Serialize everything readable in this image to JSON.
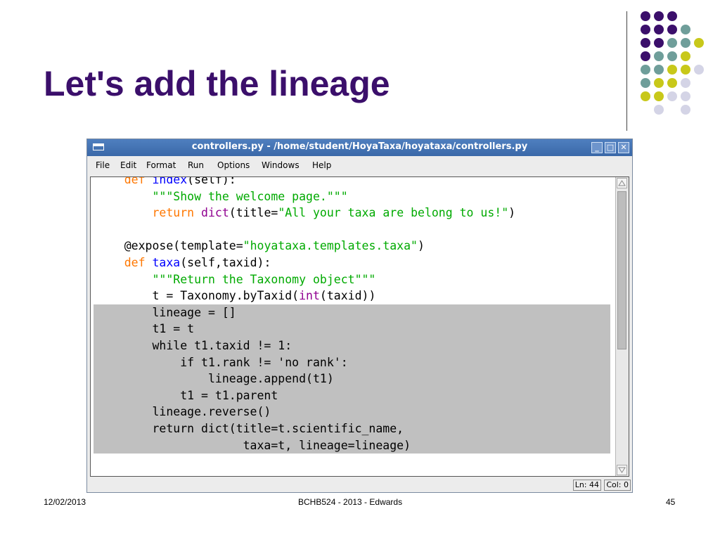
{
  "slide": {
    "title": "Let's add the lineage",
    "footer_date": "12/02/2013",
    "footer_center": "BCHB524 - 2013 - Edwards",
    "footer_page": "45"
  },
  "window": {
    "title": "controllers.py - /home/student/HoyaTaxa/hoyataxa/controllers.py",
    "minimize": "_",
    "maximize": "□",
    "close": "✕"
  },
  "menu": {
    "file": "File",
    "edit": "Edit",
    "format": "Format",
    "run": "Run",
    "options": "Options",
    "windows": "Windows",
    "help": "Help"
  },
  "code": {
    "l1": {
      "kw": "def",
      "name": "index",
      "rest": "(self):"
    },
    "l2": "\"\"\"Show the welcome page.\"\"\"",
    "l3": {
      "kw": "return",
      "bi": "dict",
      "a": "(title=",
      "str": "\"All your taxa are belong to us!\"",
      "b": ")"
    },
    "l5": {
      "a": "@expose(template=",
      "str": "\"hoyataxa.templates.taxa\"",
      "b": ")"
    },
    "l6": {
      "kw": "def",
      "name": "taxa",
      "rest": "(self,taxid):"
    },
    "l7": "\"\"\"Return the Taxonomy object\"\"\"",
    "l8": {
      "a": "t = Taxonomy.byTaxid(",
      "bi": "int",
      "b": "(taxid))"
    },
    "l9": "lineage = []",
    "l10": "t1 = t",
    "l11": "while t1.taxid != 1:",
    "l12": "if t1.rank != 'no rank':",
    "l13": "lineage.append(t1)",
    "l14": "t1 = t1.parent",
    "l15": "lineage.reverse()",
    "l16": "return dict(title=t.scientific_name,",
    "l17": "taxa=t, lineage=lineage)"
  },
  "status": {
    "line": "Ln: 44",
    "col": "Col: 0"
  },
  "colors": {
    "title": "#3b0f6b",
    "keyword": "#ff7700",
    "function_name": "#0000ff",
    "string": "#00aa00",
    "builtin": "#900090",
    "selection": "#c0c0c0",
    "dot_purple": "#3b0f6b",
    "dot_teal": "#6f9e9a",
    "dot_yellow": "#c8c81a",
    "dot_lavender": "#d4d4e6"
  }
}
